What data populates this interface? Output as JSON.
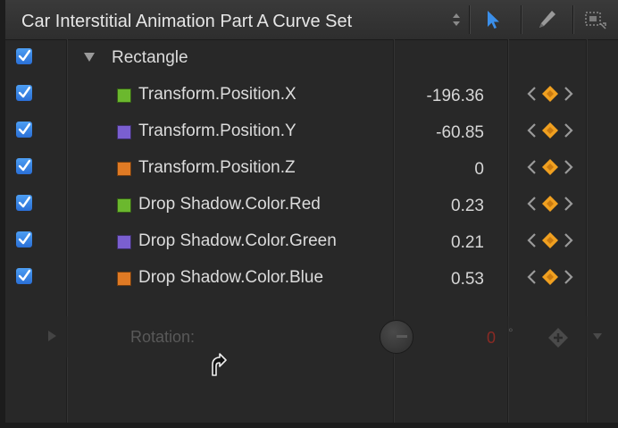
{
  "header": {
    "curve_set_label": "Car Interstitial Animation Part A Curve Set",
    "tools": [
      "arrow-select-tool-icon",
      "pen-tool-icon",
      "marquee-tool-icon"
    ]
  },
  "colors": {
    "checkbox_blue": "#3a8ae8",
    "green": "#6bb82e",
    "purple": "#7a5fd0",
    "orange": "#e07a24",
    "keyframe_orange": "#f0a020",
    "rotation_value_red": "#8a2a24"
  },
  "group": {
    "label": "Rectangle",
    "checked": true
  },
  "parameters": [
    {
      "label": "Transform.Position.X",
      "value": "-196.36",
      "color": "#6bb82e",
      "checked": true
    },
    {
      "label": "Transform.Position.Y",
      "value": "-60.85",
      "color": "#7a5fd0",
      "checked": true
    },
    {
      "label": "Transform.Position.Z",
      "value": "0",
      "color": "#e07a24",
      "checked": true
    },
    {
      "label": "Drop Shadow.Color.Red",
      "value": "0.23",
      "color": "#6bb82e",
      "checked": true
    },
    {
      "label": "Drop Shadow.Color.Green",
      "value": "0.21",
      "color": "#7a5fd0",
      "checked": true
    },
    {
      "label": "Drop Shadow.Color.Blue",
      "value": "0.53",
      "color": "#e07a24",
      "checked": true
    }
  ],
  "rotation": {
    "label": "Rotation:",
    "value": "0",
    "unit": "°"
  }
}
